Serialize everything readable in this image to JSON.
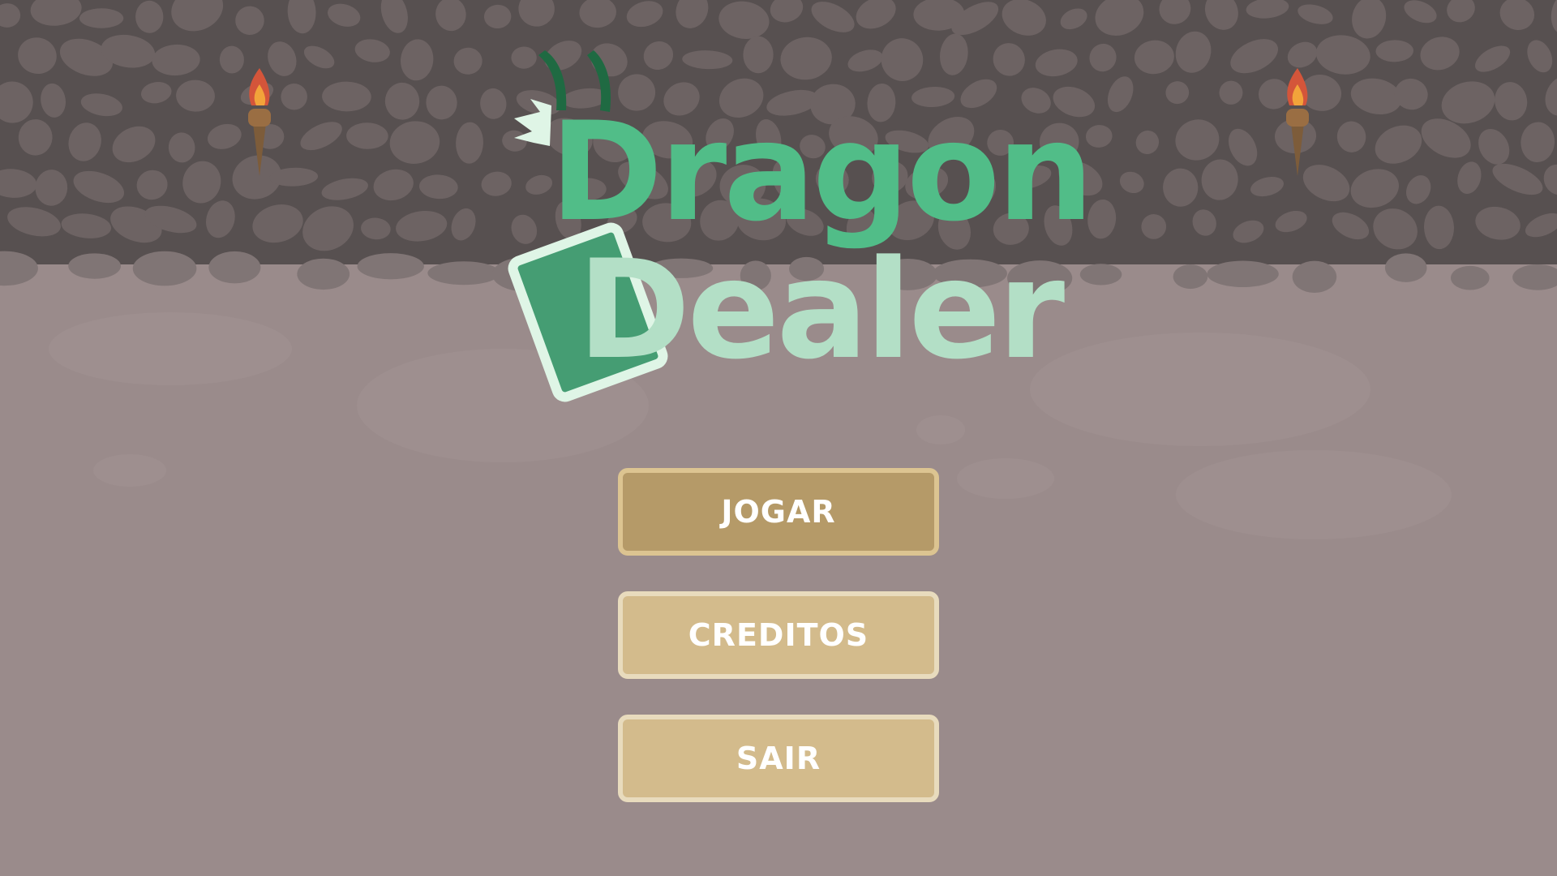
{
  "game": {
    "title_line1": "Dragon",
    "title_line2": "Dealer"
  },
  "menu": {
    "play_label": "JOGAR",
    "credits_label": "CREDITOS",
    "exit_label": "SAIR"
  },
  "colors": {
    "wall": "#575050",
    "floor": "#9a8b8b",
    "title_primary": "#51bd88",
    "title_secondary": "#b3dfc6",
    "button_active": "#b59a68",
    "button_default": "#d3bb8c"
  },
  "icons": {
    "torch_left": "torch-icon",
    "torch_right": "torch-icon",
    "card": "card-icon",
    "dragon_horns": "horns-icon"
  }
}
